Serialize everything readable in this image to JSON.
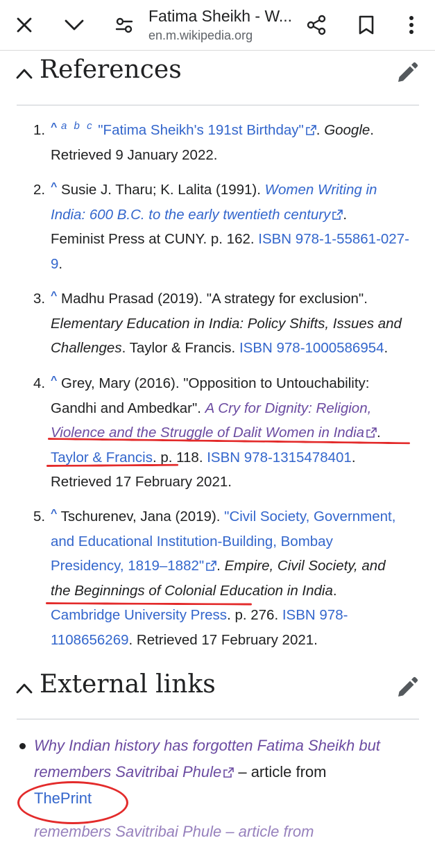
{
  "toolbar": {
    "title": "Fatima Sheikh - W...",
    "url": "en.m.wikipedia.org"
  },
  "sections": {
    "references_title": "References",
    "external_links_title": "External links"
  },
  "references": [
    {
      "num": "1.",
      "caret": "^",
      "backlinks": "a b c",
      "line1_link": "\"Fatima Sheikh's 191st Birthday\"",
      "line1_sep": ". ",
      "line1_pub": "Google",
      "line1_end": ".",
      "line2": "Retrieved 9 January 2022."
    },
    {
      "num": "2.",
      "caret": "^",
      "line1_text": "Susie J. Tharu; K. Lalita (1991). ",
      "line1_link": "Women Writing in",
      "line2_link": "India: 600 B.C. to the early twentieth century",
      "line2_end": ".",
      "line3_text": "Feminist Press at CUNY. p. 162. ",
      "line3_isbn": "ISBN 978-1-55861-027-",
      "line4_isbn": "9",
      "line4_end": "."
    },
    {
      "num": "3.",
      "caret": "^",
      "line1": "Madhu Prasad (2019). \"A strategy for exclusion\".",
      "line2": "Elementary Education in India: Policy Shifts, Issues and",
      "line3_italic": "Challenges",
      "line3_text": ". Taylor & Francis. ",
      "line3_isbn": "ISBN 978-1000586954",
      "line3_end": "."
    },
    {
      "num": "4.",
      "caret": "^",
      "line1": "Grey, Mary (2016). \"Opposition to Untouchability:",
      "line2_text": "Gandhi and Ambedkar\". ",
      "line2_link": "A Cry for Dignity: Religion,",
      "line3_link": "Violence and the Struggle of Dalit Women in India",
      "line3_end": ".",
      "line4_publisher": "Taylor & Francis",
      "line4_text": ". p. 118. ",
      "line4_isbn": "ISBN 978-1315478401",
      "line4_end": ".",
      "line5": "Retrieved 17 February 2021."
    },
    {
      "num": "5.",
      "caret": "^",
      "line1_text": "Tschurenev, Jana (2019). ",
      "line1_link": "\"Civil Society, Government,",
      "line2_link": "and Educational Institution-Building, Bombay",
      "line3_link": "Presidency, 1819–1882\"",
      "line3_text": ". ",
      "line3_italic": "Empire, Civil Society, and",
      "line4_italic": "the Beginnings of Colonial Education in India",
      "line4_end": ".",
      "line5_publisher": "Cambridge University Press",
      "line5_text": ". p. 276. ",
      "line5_isbn": "ISBN 978-",
      "line6_isbn": "1108656269",
      "line6_text": ". Retrieved 17 February 2021."
    }
  ],
  "external_links": [
    {
      "line1_link": "Why Indian history has forgotten Fatima Sheikh but",
      "line2_link": "remembers Savitribai Phule",
      "line2_text": " – article from",
      "line3_link": "ThePrint"
    }
  ],
  "cutoff_text": "remembers Savitribai Phule – article from",
  "colors": {
    "link": "#3366cc",
    "visited_link": "#6b4ba1",
    "annotation_red": "#e32b2b",
    "text": "#202122"
  }
}
